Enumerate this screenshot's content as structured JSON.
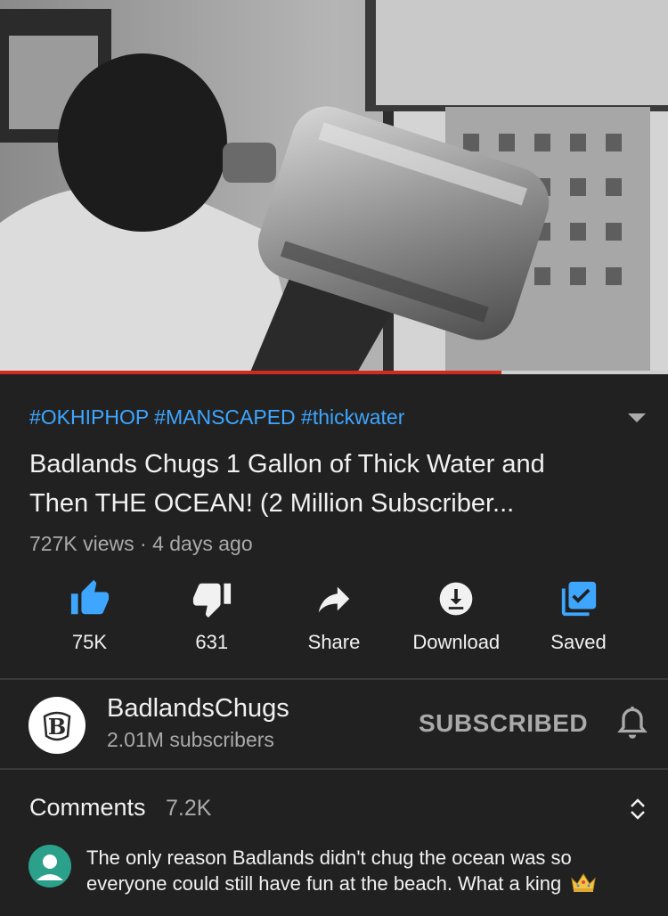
{
  "video": {
    "progress_fraction": 0.75
  },
  "meta": {
    "hashtags": "#OKHIPHOP #MANSCAPED #thickwater",
    "title": "Badlands Chugs 1 Gallon of Thick Water and Then THE OCEAN! (2 Million Subscriber...",
    "views": "727K views",
    "separator": "·",
    "age": "4 days ago"
  },
  "actions": [
    {
      "label": "75K",
      "icon": "thumbs-up-icon",
      "color": "#3ea6ff"
    },
    {
      "label": "631",
      "icon": "thumbs-down-icon",
      "color": "#f1f1f1"
    },
    {
      "label": "Share",
      "icon": "share-icon",
      "color": "#f1f1f1"
    },
    {
      "label": "Download",
      "icon": "download-icon",
      "color": "#f1f1f1"
    },
    {
      "label": "Saved",
      "icon": "saved-playlist-icon",
      "color": "#3ea6ff"
    }
  ],
  "channel": {
    "name": "BadlandsChugs",
    "subscribers": "2.01M subscribers",
    "subscribe_label": "SUBSCRIBED",
    "avatar_icon": "channel-logo-b-icon",
    "bell_icon": "notification-bell-icon"
  },
  "comments": {
    "title": "Comments",
    "count": "7.2K",
    "toggle_icon": "expand-collapse-icon",
    "top_comment": {
      "text": "The only reason Badlands didn't chug the ocean was so everyone could still have fun at the beach. What a king",
      "emoji_icon": "crown-icon",
      "avatar_color": "#2ba08b"
    }
  },
  "colors": {
    "background": "#212121",
    "accent_blue": "#3ea6ff",
    "progress_red": "#d32a1f",
    "secondary_text": "#aaaaaa"
  }
}
